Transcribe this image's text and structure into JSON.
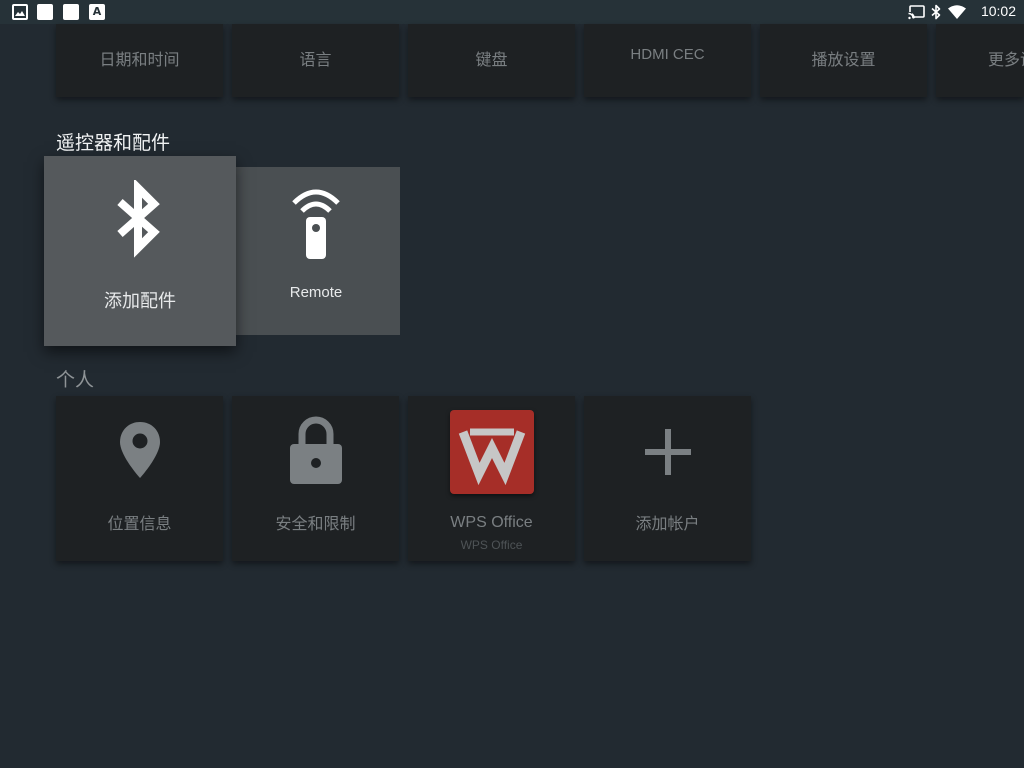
{
  "status_bar": {
    "left_icons": [
      "image-notification-icon",
      "white-square-notification-icon",
      "white-square-notification-icon",
      "a-letter-notification-icon"
    ],
    "right_icons": [
      "cast-icon",
      "bluetooth-icon",
      "wifi-icon"
    ],
    "time": "10:02"
  },
  "preferences_row": {
    "items": [
      {
        "label": "日期和时间"
      },
      {
        "label": "语言"
      },
      {
        "label": "键盘"
      },
      {
        "label": "HDMI CEC"
      },
      {
        "label": "播放设置"
      },
      {
        "label": "更多设"
      }
    ]
  },
  "accessories": {
    "title": "遥控器和配件",
    "items": [
      {
        "label": "添加配件",
        "icon": "bluetooth-icon"
      },
      {
        "label": "Remote",
        "icon": "remote-icon"
      }
    ]
  },
  "personal": {
    "title": "个人",
    "items": [
      {
        "label": "位置信息",
        "icon": "location-pin-icon"
      },
      {
        "label": "安全和限制",
        "icon": "lock-icon"
      },
      {
        "label": "WPS Office",
        "sublabel": "WPS Office",
        "icon": "wps-office-logo-icon"
      },
      {
        "label": "添加帐户",
        "icon": "plus-icon"
      }
    ]
  },
  "colors": {
    "background": "#222a31",
    "status_bar": "#263238",
    "card": "#1e2123",
    "focused_card": "#55595c",
    "wps_red": "#a62e28"
  }
}
